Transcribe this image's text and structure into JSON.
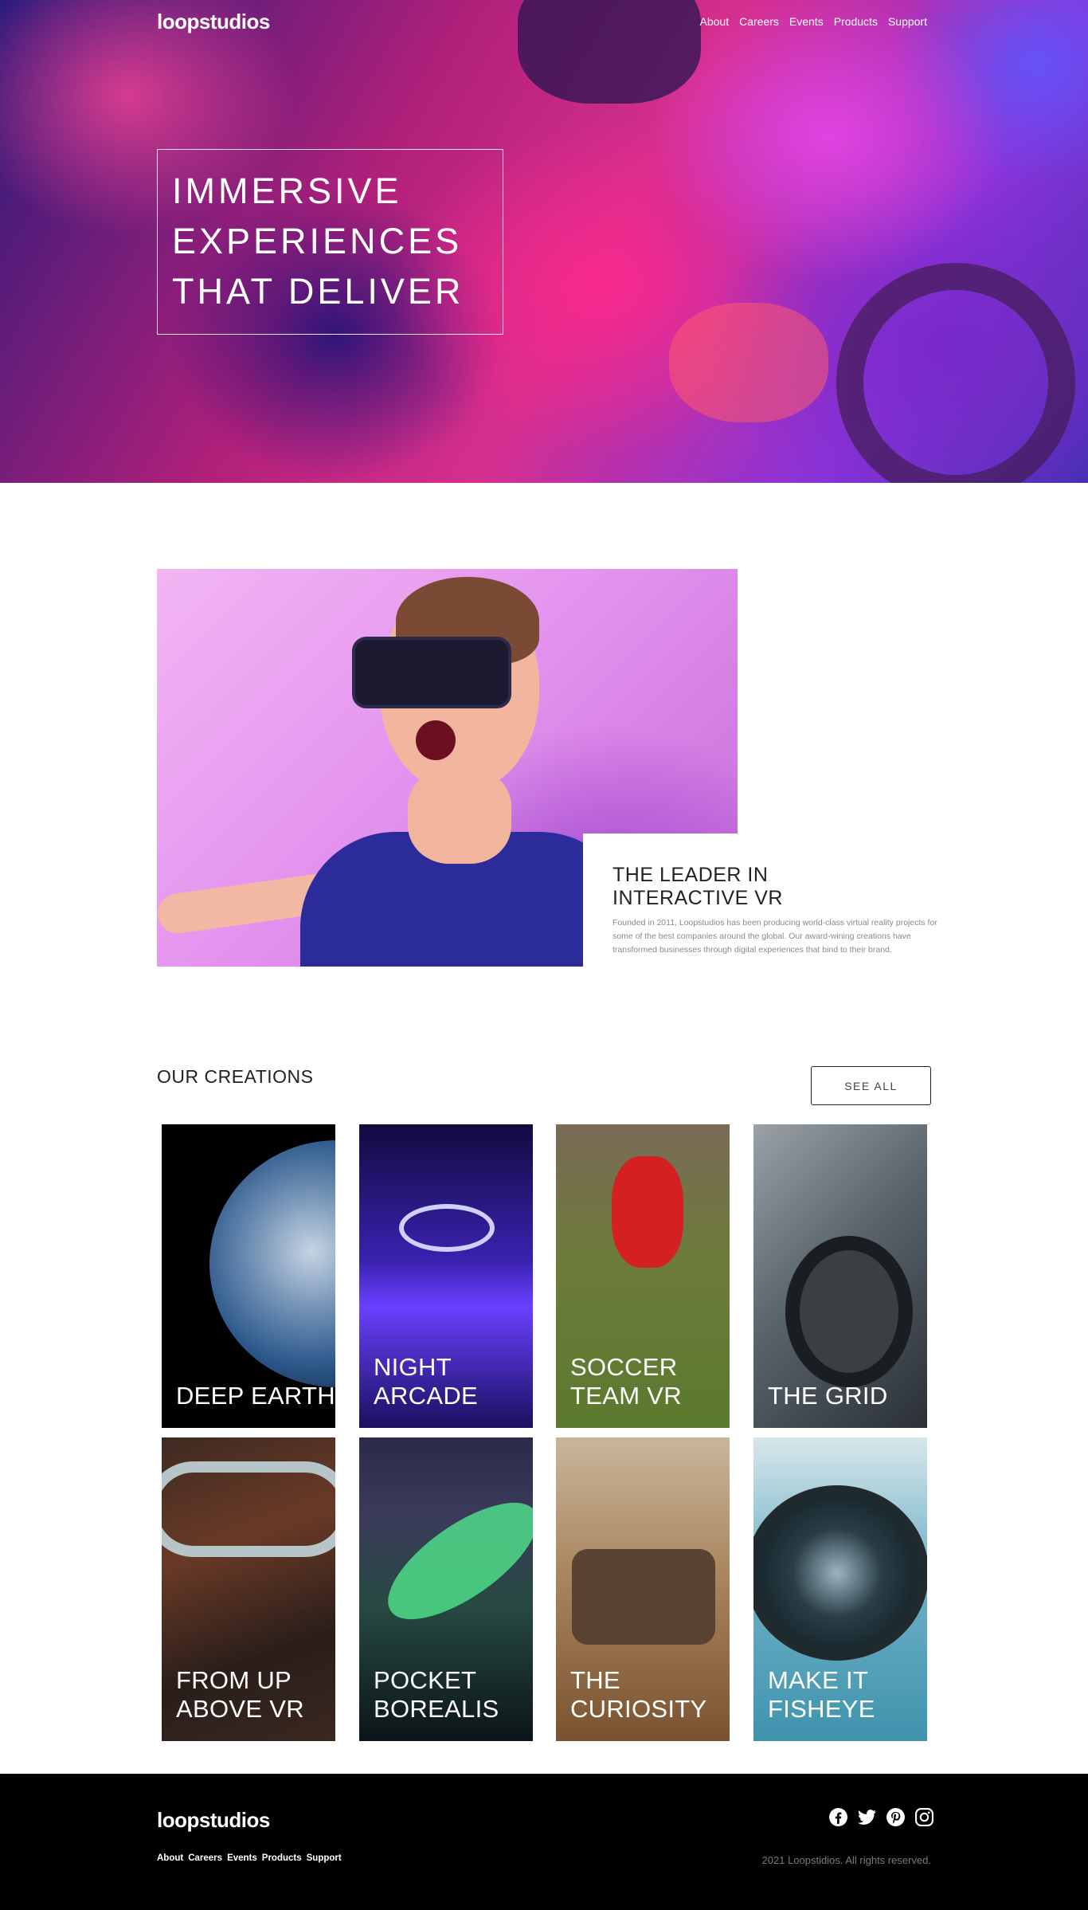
{
  "brand": {
    "logo": "loopstudios"
  },
  "header": {
    "nav": [
      "About",
      "Careers",
      "Events",
      "Products",
      "Support"
    ]
  },
  "hero": {
    "title": "IMMERSIVE\nEXPERIENCES\nTHAT DELIVER"
  },
  "intro": {
    "title": "THE LEADER IN\nINTERACTIVE VR",
    "body": "Founded in 2011, Loopstudios has been producing world-class virtual reality projects for some of the best companies around the global. Our award-wining creations have transformed businesses through digital experiences that bind to their brand."
  },
  "creations": {
    "title": "OUR CREATIONS",
    "see_all": "SEE ALL",
    "items": [
      {
        "label": "DEEP EARTH"
      },
      {
        "label": "NIGHT\nARCADE"
      },
      {
        "label": "SOCCER\nTEAM VR"
      },
      {
        "label": "THE GRID"
      },
      {
        "label": "FROM UP\nABOVE VR"
      },
      {
        "label": "POCKET\nBOREALIS"
      },
      {
        "label": "THE\nCURIOSITY"
      },
      {
        "label": "MAKE IT\nFISHEYE"
      }
    ]
  },
  "footer": {
    "logo": "loopstudios",
    "nav": [
      "About",
      "Careers",
      "Events",
      "Products",
      "Support"
    ],
    "socials": [
      "facebook-icon",
      "twitter-icon",
      "pinterest-icon",
      "instagram-icon"
    ],
    "copyright": "2021 Loopstidios. All rights reserved."
  }
}
